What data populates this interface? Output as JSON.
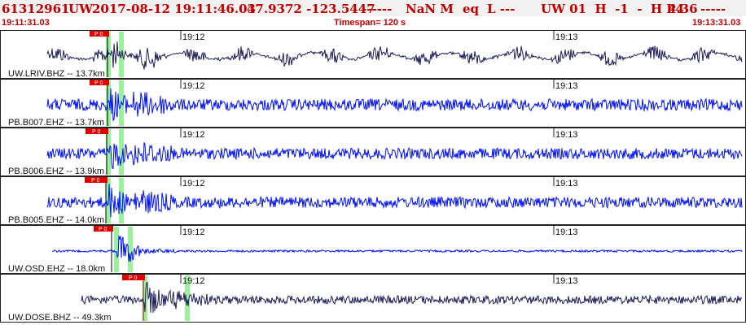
{
  "header": {
    "event_id": "61312961",
    "network": "UW",
    "datetime": "2017-08-12 19:11:46.03",
    "lat_lon": "47.9372 -123.5447",
    "dashes1": "------",
    "magnitude": "NaN M",
    "event_type": "eq",
    "event_flags": "L ---",
    "author_info": "UW 01  H  -1  -  H P4",
    "value": "4.36",
    "dashes2": "-----"
  },
  "time_bar": {
    "start": "19:11:31.03",
    "timespan": "Timespan= 120 s",
    "end": "19:13:31.03"
  },
  "minute_labels": [
    "19:12",
    "19:13"
  ],
  "pick_label": "P 0",
  "channels": [
    {
      "label": "UW.LRIV.BHZ -- 13.7km",
      "color": "#1e1e5a",
      "amplitude": 0.55
    },
    {
      "label": "PB.B007.EHZ -- 13.7km",
      "color": "#0010ff",
      "amplitude": 0.85
    },
    {
      "label": "PB.B006.EHZ -- 13.9km",
      "color": "#0010ff",
      "amplitude": 0.8
    },
    {
      "label": "PB.B005.EHZ -- 14.0km",
      "color": "#0010ff",
      "amplitude": 0.8
    },
    {
      "label": "UW.OSD.EHZ -- 18.0km",
      "color": "#0010ff",
      "amplitude": 0.15
    },
    {
      "label": "UW.DOSE.BHZ -- 49.3km",
      "color": "#1e1e5a",
      "amplitude": 0.6
    }
  ],
  "colors": {
    "header_bg": "#f1f1f1",
    "header_text": "#c00000",
    "pick_box": "#e00000",
    "pick_window": "#90ee90",
    "trace_blue": "#0010ff",
    "trace_navy": "#1e1e5a"
  }
}
